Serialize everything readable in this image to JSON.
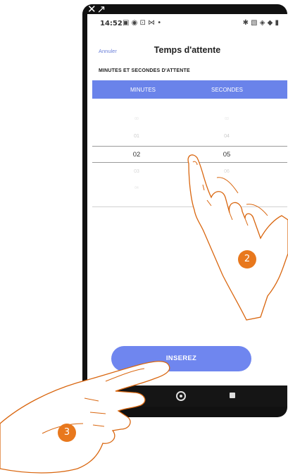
{
  "system": {
    "window_icons": "✕↗"
  },
  "status_bar": {
    "time": "14:52",
    "left_icons": "▣ ◉ ⊡ ⋈ •",
    "right_icons": "✱ ▧ ◈ ◆ ▮"
  },
  "header": {
    "cancel_label": "Annuler",
    "title": "Temps d'attente"
  },
  "section_label": "MINUTES ET SECONDES D'ATTENTE",
  "columns": {
    "minutes": "MINUTES",
    "seconds": "SECONDES"
  },
  "picker": {
    "minutes": {
      "above2": "00",
      "above1": "01",
      "selected": "02",
      "below1": "03",
      "below2": "04"
    },
    "seconds": {
      "above2": "03",
      "above1": "04",
      "selected": "05",
      "below1": "06"
    }
  },
  "insert_button": "INSEREZ",
  "badges": {
    "step2": "2",
    "step3": "3"
  },
  "colors": {
    "accent": "#6a83ea",
    "badge": "#e8781d",
    "hand_outline": "#d9660f"
  },
  "icons": {
    "nav_back": "back-triangle",
    "nav_home": "home-circle",
    "nav_recent": "recent-square"
  }
}
